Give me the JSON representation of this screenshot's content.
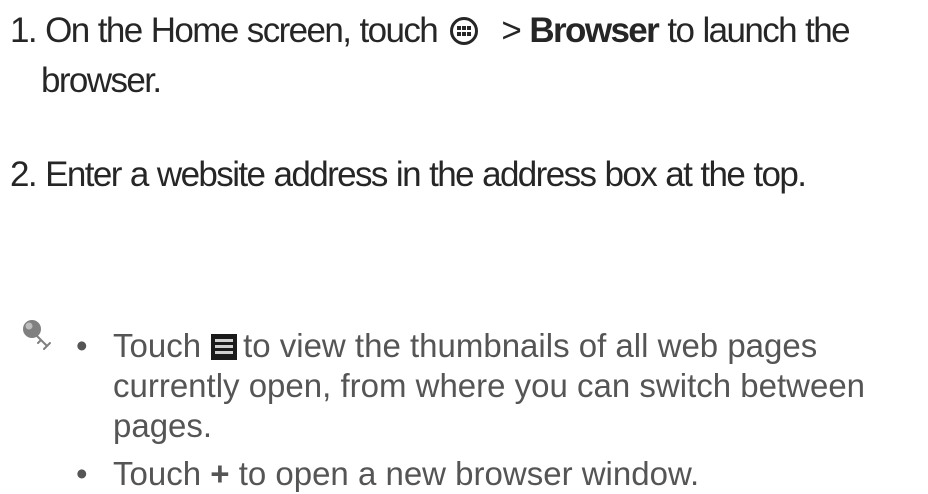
{
  "steps": [
    {
      "number": "1.",
      "before_icon": "On the Home screen, touch",
      "icon": "apps-icon",
      "separator": ">",
      "bold": "Browser",
      "after_bold": "to launch the",
      "continuation": "browser."
    },
    {
      "number": "2.",
      "text": "Enter a website address in the address box at the top."
    }
  ],
  "tip_icon": "tip-key-icon",
  "tips": [
    {
      "bullet": "•",
      "line1_before_icon": "Touch",
      "icon": "tabs-icon",
      "line1_after_icon": "to view the thumbnails of all web pages",
      "line2": "currently open, from where you can switch between",
      "line3": "pages."
    },
    {
      "bullet": "•",
      "before_symbol": "Touch",
      "symbol": "+",
      "after_symbol": "to open a new browser window."
    }
  ]
}
